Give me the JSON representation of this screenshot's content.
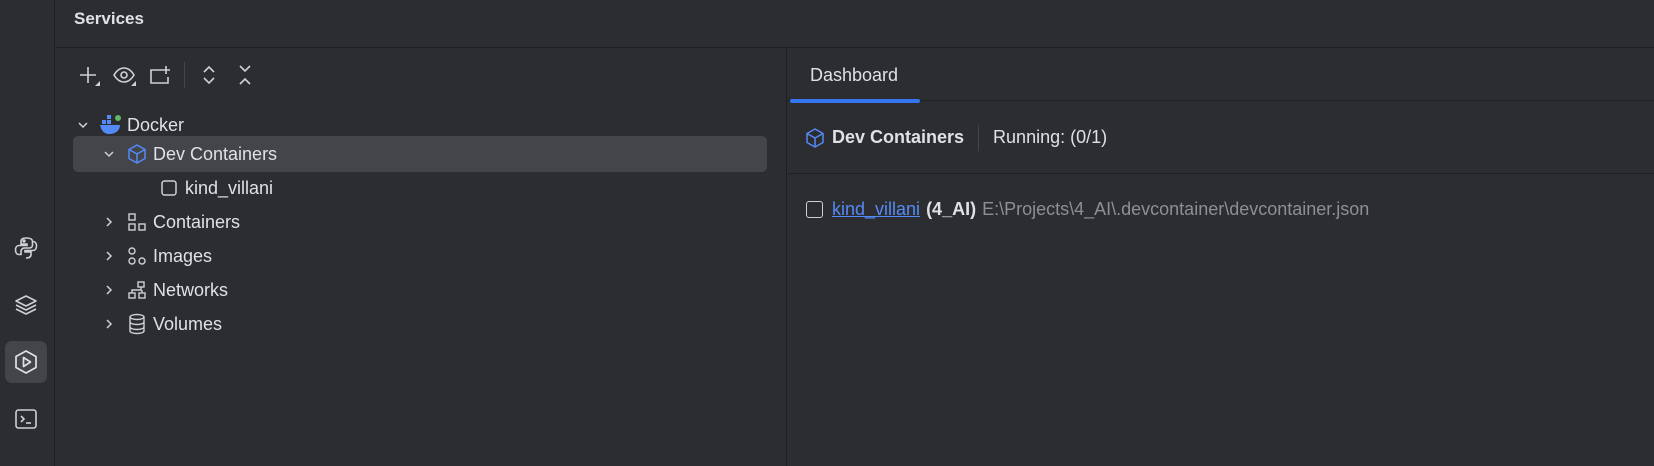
{
  "header": {
    "title": "Services"
  },
  "toolbar": {
    "icons": [
      "add-icon",
      "eye-icon",
      "new-tab-icon",
      "expand-all-icon",
      "collapse-all-icon"
    ]
  },
  "tree": {
    "root": {
      "label": "Docker",
      "icon": "docker-icon",
      "expanded": true
    },
    "dev_containers": {
      "label": "Dev Containers",
      "icon": "cube-icon",
      "expanded": true,
      "selected": true
    },
    "dev_item": {
      "label": "kind_villani",
      "icon": "container-checkbox-icon"
    },
    "containers": {
      "label": "Containers",
      "icon": "containers-icon"
    },
    "images": {
      "label": "Images",
      "icon": "images-icon"
    },
    "networks": {
      "label": "Networks",
      "icon": "networks-icon"
    },
    "volumes": {
      "label": "Volumes",
      "icon": "volumes-icon"
    }
  },
  "dashboard": {
    "tab": "Dashboard",
    "group_name": "Dev Containers",
    "running": "Running: (0/1)",
    "item": {
      "name": "kind_villani",
      "project": "(4_AI)",
      "path": "E:\\Projects\\4_AI\\.devcontainer\\devcontainer.json"
    }
  },
  "strip": {
    "icons": [
      "python-icon",
      "layers-icon",
      "services-icon",
      "terminal-icon"
    ],
    "active": "services-icon"
  },
  "colors": {
    "accent": "#3574f0",
    "link": "#548af7",
    "background": "#2b2d30",
    "selected": "#43454a"
  }
}
